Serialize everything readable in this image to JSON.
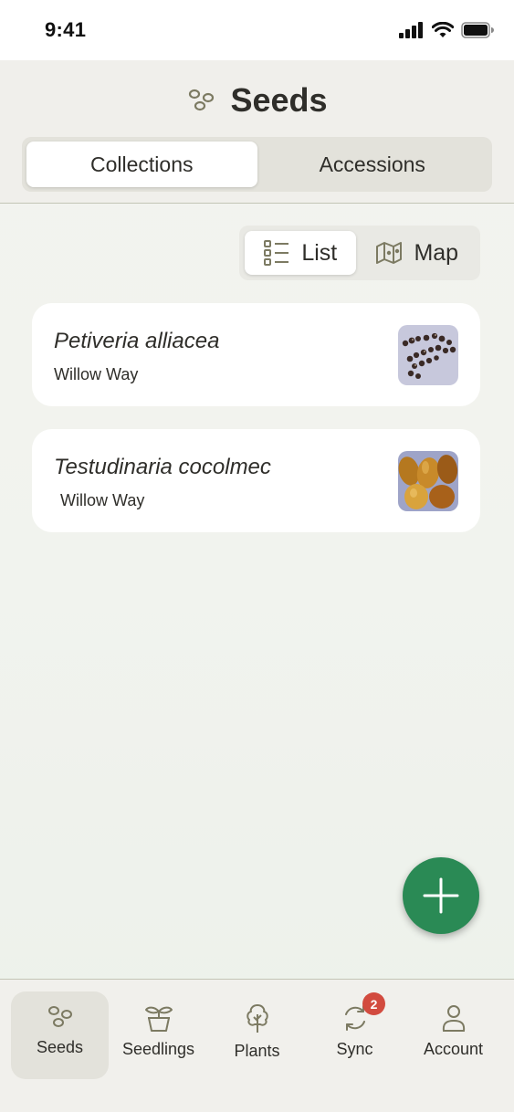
{
  "status_bar": {
    "time": "9:41"
  },
  "header": {
    "title": "Seeds",
    "title_icon": "seeds-icon",
    "segments": [
      "Collections",
      "Accessions"
    ],
    "active_segment": "Collections"
  },
  "view_toggle": {
    "list_label": "List",
    "map_label": "Map",
    "active": "List"
  },
  "collections": [
    {
      "name": "Petiveria alliacea",
      "location": "Willow Way",
      "thumbnail": "small dark seeds on pale background"
    },
    {
      "name": "Testudinaria cocolmec",
      "location": "Willow Way",
      "thumbnail": "large golden-brown seeds"
    }
  ],
  "fab": {
    "icon": "plus-icon"
  },
  "tabbar": {
    "items": [
      {
        "label": "Seeds",
        "icon": "seeds-icon",
        "active": true
      },
      {
        "label": "Seedlings",
        "icon": "seedling-pot-icon",
        "active": false
      },
      {
        "label": "Plants",
        "icon": "tree-icon",
        "active": false
      },
      {
        "label": "Sync",
        "icon": "sync-icon",
        "active": false,
        "badge": "2"
      },
      {
        "label": "Account",
        "icon": "user-icon",
        "active": false
      }
    ]
  },
  "colors": {
    "accent_green": "#2a8a55",
    "badge_red": "#d24b3f",
    "icon_olive": "#7c7a62"
  }
}
